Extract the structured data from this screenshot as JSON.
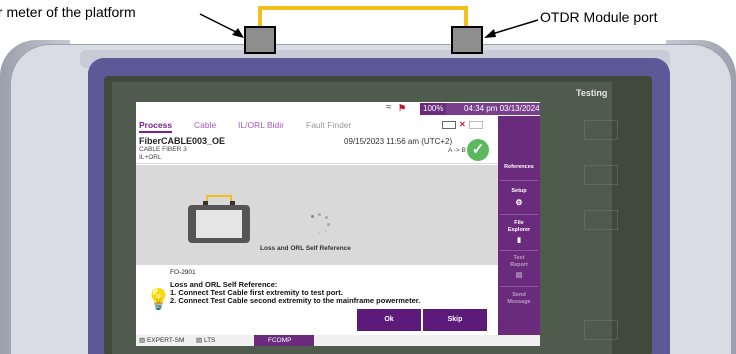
{
  "callouts": {
    "left": "wer meter of the platform",
    "right": "OTDR Module port"
  },
  "device": {
    "brand_label": "Testing"
  },
  "statusbar": {
    "battery": "100%",
    "time": "04:34 pm 03/13/2024"
  },
  "tabs": [
    {
      "label": "Process",
      "state": "active"
    },
    {
      "label": "Cable",
      "state": "normal"
    },
    {
      "label": "IL/ORL Bidir",
      "state": "normal"
    },
    {
      "label": "Fault Finder",
      "state": "disabled"
    }
  ],
  "header": {
    "title": "FiberCABLE003_OE",
    "cable": "CABLE FIBER 3",
    "mode": "IL+ORL",
    "datetime": "09/15/2023 11:56 am (UTC+2)",
    "direction": "A -> B"
  },
  "work_area": {
    "caption": "Loss and ORL Self Reference"
  },
  "dialog": {
    "code": "FO-2901",
    "title": "Loss and ORL Self Reference:",
    "step1": "1. Connect Test Cable first extremity to test port.",
    "step2": "2. Connect Test Cable second extremity to the mainframe powermeter.",
    "ok_label": "Ok",
    "skip_label": "Skip"
  },
  "sidebar": {
    "references": "References",
    "setup": "Setup",
    "file_explorer_1": "File",
    "file_explorer_2": "Explorer",
    "test_report_1": "Test",
    "test_report_2": "Report",
    "send_message_1": "Send",
    "send_message_2": "Message"
  },
  "footer": {
    "item1": "EXPERT-SM",
    "item2": "LTS",
    "item3": "FCOMP"
  },
  "colors": {
    "accent": "#6a2b7c",
    "button": "#5c1a79",
    "cable": "#f2c01c",
    "success": "#5cb85c"
  }
}
